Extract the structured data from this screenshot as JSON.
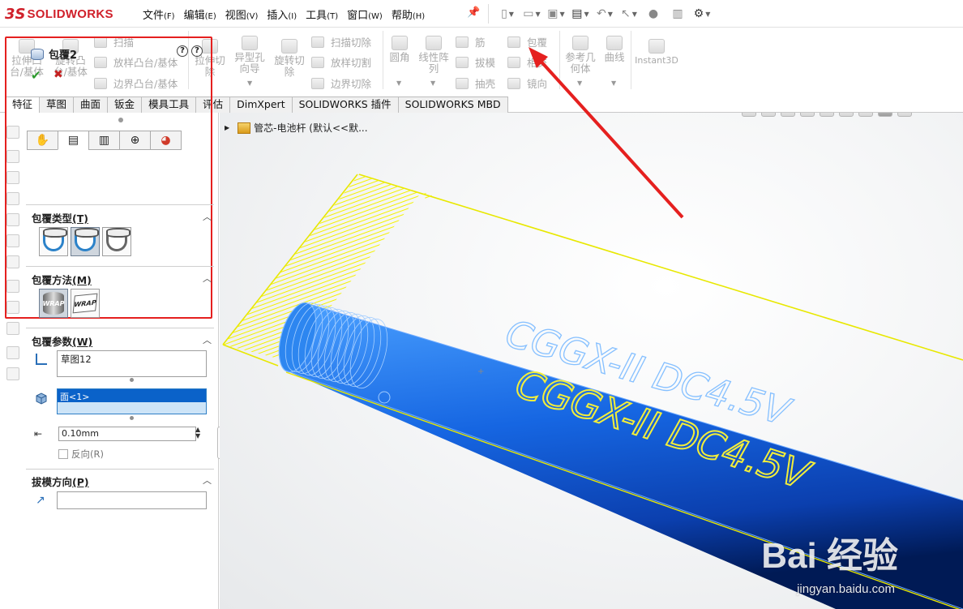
{
  "app": {
    "brand_prefix": "3S",
    "brand": "SOLIDWORKS"
  },
  "menu": [
    {
      "label": "文件",
      "acc": "(F)"
    },
    {
      "label": "编辑",
      "acc": "(E)"
    },
    {
      "label": "视图",
      "acc": "(V)"
    },
    {
      "label": "插入",
      "acc": "(I)"
    },
    {
      "label": "工具",
      "acc": "(T)"
    },
    {
      "label": "窗口",
      "acc": "(W)"
    },
    {
      "label": "帮助",
      "acc": "(H)"
    }
  ],
  "commands": {
    "extrude_boss": "拉伸凸\n台/基体",
    "revolve_boss": "旋转凸\n台/基体",
    "sweep": "扫描",
    "loft_boss": "放样凸台/基体",
    "boundary_boss": "边界凸台/基体",
    "extrude_cut": "拉伸切\n除",
    "hole_wizard": "异型孔\n向导",
    "revolve_cut": "旋转切\n除",
    "sweep_cut": "扫描切除",
    "loft_cut": "放样切割",
    "boundary_cut": "边界切除",
    "fillet": "圆角",
    "linear_pattern": "线性阵\n列",
    "rib": "筋",
    "draft": "拔模",
    "shell": "抽壳",
    "wrap": "包覆",
    "intersect": "相交",
    "mirror": "镜向",
    "ref_geometry": "参考几\n何体",
    "curves": "曲线",
    "instant3d": "Instant3D"
  },
  "tabs": [
    "特征",
    "草图",
    "曲面",
    "钣金",
    "模具工具",
    "评估",
    "DimXpert",
    "SOLIDWORKS 插件",
    "SOLIDWORKS MBD"
  ],
  "tree": {
    "part_name": "管芯-电池杆 (默认<<默..."
  },
  "property_manager": {
    "title": "包覆2",
    "help1": "?",
    "help2": "?",
    "ok": "✔",
    "cancel": "✖",
    "wrap_type": {
      "label": "包覆类型",
      "acc": "(T)"
    },
    "wrap_method": {
      "label": "包覆方法",
      "acc": "(M)"
    },
    "wrap_params": {
      "label": "包覆参数",
      "acc": "(W)"
    },
    "sketch_value": "草图12",
    "face_value": "面<1>",
    "thickness": "0.10mm",
    "reverse_label": "反向",
    "reverse_acc": "(R)",
    "draft_dir": {
      "label": "拔模方向",
      "acc": "(P)"
    },
    "wrap_label_1": "WRAP",
    "wrap_label_2": "WRAP"
  },
  "model": {
    "emboss_text": "CGGX-II DC4.5V",
    "colors": {
      "cylinder": "#1a66e0",
      "sketch": "#ffff33",
      "outline": "#6aa8ff"
    }
  },
  "watermark": {
    "main": "Bai 经验",
    "sub": "jingyan.baidu.com"
  }
}
